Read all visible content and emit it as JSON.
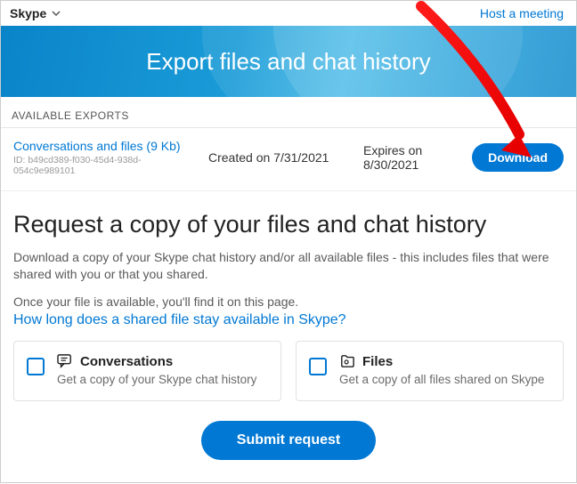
{
  "topbar": {
    "brand": "Skype",
    "host_meeting": "Host a meeting"
  },
  "banner": {
    "title": "Export files and chat history"
  },
  "exports": {
    "heading": "AVAILABLE EXPORTS",
    "item": {
      "title": "Conversations and files (9 Kb)",
      "id_label": "ID: b49cd389-f030-45d4-938d-054c9e989101",
      "created": "Created on 7/31/2021",
      "expires": "Expires on 8/30/2021",
      "download": "Download"
    }
  },
  "request": {
    "heading": "Request a copy of your files and chat history",
    "desc": "Download a copy of your Skype chat history and/or all available files - this includes files that were shared with you or that you shared.",
    "avail_note": "Once your file is available, you'll find it on this page.",
    "faq_link": "How long does a shared file stay available in Skype?"
  },
  "options": {
    "conversations": {
      "title": "Conversations",
      "desc": "Get a copy of your Skype chat history"
    },
    "files": {
      "title": "Files",
      "desc": "Get a copy of all files shared on Skype"
    }
  },
  "submit": {
    "label": "Submit request"
  }
}
